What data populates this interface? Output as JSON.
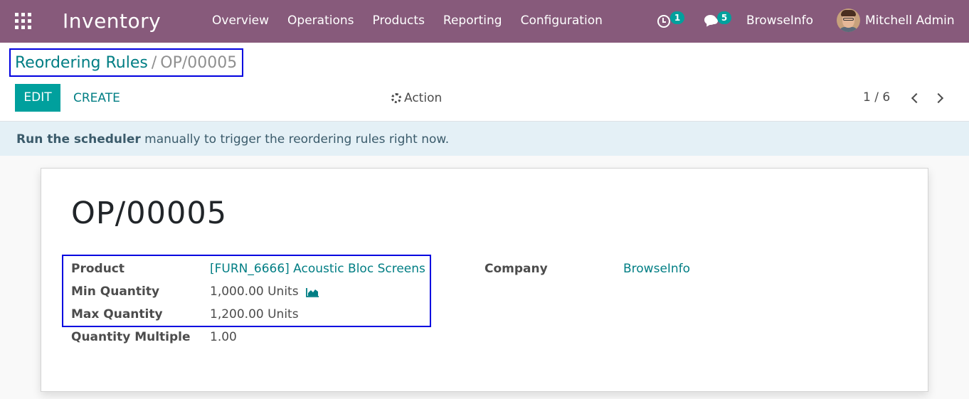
{
  "navbar": {
    "app_name": "Inventory",
    "menu": [
      "Overview",
      "Operations",
      "Products",
      "Reporting",
      "Configuration"
    ],
    "activity_count": "1",
    "message_count": "5",
    "company": "BrowseInfo",
    "user": "Mitchell Admin"
  },
  "breadcrumb": {
    "parent": "Reordering Rules",
    "separator": "/",
    "current": "OP/00005"
  },
  "buttons": {
    "edit": "EDIT",
    "create": "CREATE",
    "action": "Action"
  },
  "pager": {
    "value": "1 / 6"
  },
  "alert": {
    "bold": "Run the scheduler",
    "text": " manually to trigger the reordering rules right now."
  },
  "record": {
    "title": "OP/00005",
    "fields": {
      "product_label": "Product",
      "product_value": "[FURN_6666] Acoustic Bloc Screens",
      "min_label": "Min Quantity",
      "min_value": "1,000.00 Units",
      "max_label": "Max Quantity",
      "max_value": "1,200.00 Units",
      "multiple_label": "Quantity Multiple",
      "multiple_value": "1.00",
      "company_label": "Company",
      "company_value": "BrowseInfo"
    }
  },
  "colors": {
    "navbar": "#875a7b",
    "primary": "#00a09d",
    "link": "#017e84",
    "highlight": "#0000e0"
  },
  "icons": [
    "apps-grid-icon",
    "clock-icon",
    "chat-icon",
    "gear-icon",
    "chevron-left-icon",
    "chevron-right-icon",
    "area-chart-icon"
  ]
}
